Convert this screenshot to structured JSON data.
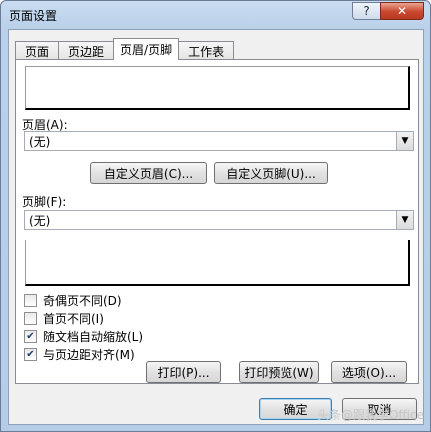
{
  "window": {
    "title": "页面设置",
    "help_glyph": "?",
    "close_glyph": "✕"
  },
  "tabs": [
    {
      "label": "页面"
    },
    {
      "label": "页边距"
    },
    {
      "label": "页眉/页脚"
    },
    {
      "label": "工作表"
    }
  ],
  "header": {
    "label": "页眉(A):",
    "value": "(无)",
    "custom_button": "自定义页眉(C)..."
  },
  "footer": {
    "label": "页脚(F):",
    "value": "(无)",
    "custom_button": "自定义页脚(U)..."
  },
  "options": [
    {
      "label": "奇偶页不同(D)",
      "checked": false
    },
    {
      "label": "首页不同(I)",
      "checked": false
    },
    {
      "label": "随文档自动缩放(L)",
      "checked": true
    },
    {
      "label": "与页边距对齐(M)",
      "checked": true
    }
  ],
  "actions": {
    "print": "打印(P)...",
    "print_preview": "打印预览(W)",
    "options": "选项(O)..."
  },
  "dialog": {
    "ok": "确定",
    "cancel": "取消"
  },
  "watermark": "头条@跟我学Office",
  "dropdown_arrow": "▼",
  "check_mark": "✔"
}
